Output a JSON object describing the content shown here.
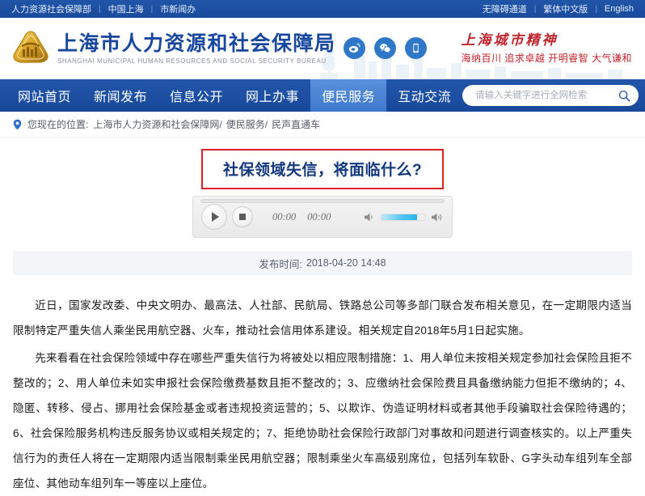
{
  "topbar": {
    "left_links": [
      "人力资源社会保障部",
      "中国上海",
      "市新闻办"
    ],
    "right_links": [
      "无障碍通道",
      "繁体中文版",
      "English"
    ],
    "separator": "|",
    "bg_color": "#1b4fa0"
  },
  "header": {
    "logo_icon": "bureau-emblem-icon",
    "title_cn": "上海市人力资源和社会保障局",
    "title_en": "SHANGHAI MUNICIPAL HUMAN RESOURCES AND SOCIAL SECURITY BUREAU",
    "title_color": "#17479e",
    "social": [
      {
        "name": "weibo-icon",
        "glyph": "微"
      },
      {
        "name": "wechat-icon",
        "glyph": "信"
      },
      {
        "name": "mobile-icon",
        "glyph": "手"
      }
    ],
    "spirit_title": "上海城市精神",
    "spirit_slogan": "海纳百川 追求卓越 开明睿智 大气谦和",
    "spirit_color": "#c0242c"
  },
  "nav": {
    "items": [
      {
        "label": "网站首页",
        "active": false
      },
      {
        "label": "新闻发布",
        "active": false
      },
      {
        "label": "信息公开",
        "active": false
      },
      {
        "label": "网上办事",
        "active": false
      },
      {
        "label": "便民服务",
        "active": true
      },
      {
        "label": "互动交流",
        "active": false
      }
    ],
    "active_color": "#4c84d4",
    "bg_color": "#1c50a2"
  },
  "search": {
    "placeholder": "请输入关键字进行全网检索",
    "value": "",
    "icon": "search-icon"
  },
  "breadcrumb": {
    "pin_icon": "location-pin-icon",
    "label": "您现在的位置:",
    "items": [
      "上海市人力资源和社会保障网",
      "便民服务",
      "民声直通车"
    ],
    "separator": "/"
  },
  "article": {
    "title": "社保领域失信，将面临什么?",
    "title_color": "#13387e",
    "title_border_color": "#e02020",
    "publish_label": "发布时间:",
    "publish_time": "2018-04-20 14:48",
    "paragraphs": [
      "近日，国家发改委、中央文明办、最高法、人社部、民航局、铁路总公司等多部门联合发布相关意见，在一定期限内适当限制特定严重失信人乘坐民用航空器、火车，推动社会信用体系建设。相关规定自2018年5月1日起实施。",
      "先来看看在社会保险领域中存在哪些严重失信行为将被处以相应限制措施：1、用人单位未按相关规定参加社会保险且拒不整改的；2、用人单位未如实申报社会保险缴费基数且拒不整改的；3、应缴纳社会保险费且具备缴纳能力但拒不缴纳的；4、隐匿、转移、侵占、挪用社会保险基金或者违规投资运营的；5、以欺诈、伪造证明材料或者其他手段骗取社会保险待遇的；6、社会保险服务机构违反服务协议或相关规定的；7、拒绝协助社会保险行政部门对事故和问题进行调查核实的。以上严重失信行为的责任人将在一定期限内适当限制乘坐民用航空器；限制乘坐火车高级别席位，包括列车软卧、G字头动车组列车全部座位、其他动车组列车一等座以上座位。"
    ]
  },
  "player": {
    "play_icon": "play-icon",
    "stop_icon": "stop-icon",
    "current_time": "00:00",
    "total_time": "00:00",
    "volume_down_icon": "volume-low-icon",
    "volume_up_icon": "volume-high-icon",
    "volume_percent": 82,
    "progress_percent": 0
  }
}
